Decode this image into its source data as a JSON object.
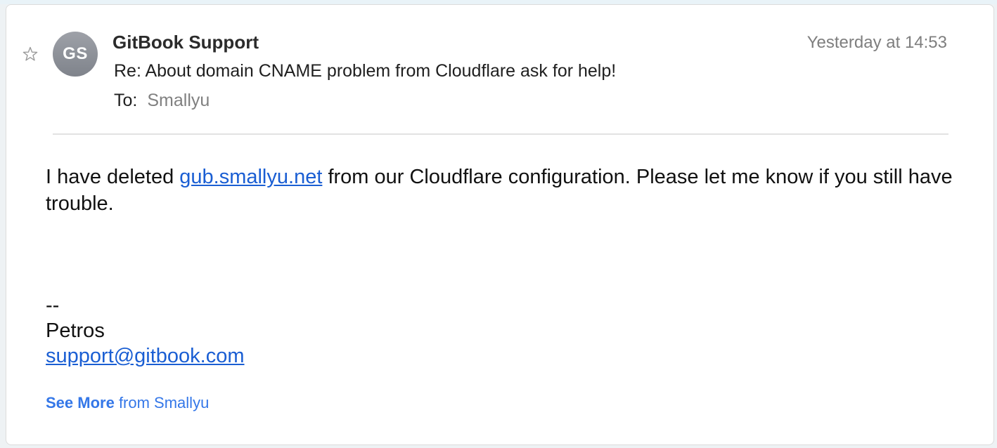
{
  "email": {
    "sender_name": "GitBook Support",
    "avatar_initials": "GS",
    "timestamp": "Yesterday at 14:53",
    "subject": "Re: About domain CNAME problem from Cloudflare ask for help!",
    "to_label": "To:",
    "to_value": "Smallyu",
    "body": {
      "before_link": "I have deleted ",
      "link_text": "gub.smallyu.net",
      "after_link": " from our Cloudflare configuration. Please let me know if you still have trouble."
    },
    "signature": {
      "separator": "--",
      "name": "Petros",
      "email": "support@gitbook.com"
    },
    "see_more": {
      "strong": "See More",
      "rest": " from Smallyu"
    }
  },
  "icons": {
    "star": "star-outline-icon"
  },
  "colors": {
    "link": "#1a5ed3",
    "see_more": "#3477e8",
    "avatar": "#8a8d94"
  }
}
